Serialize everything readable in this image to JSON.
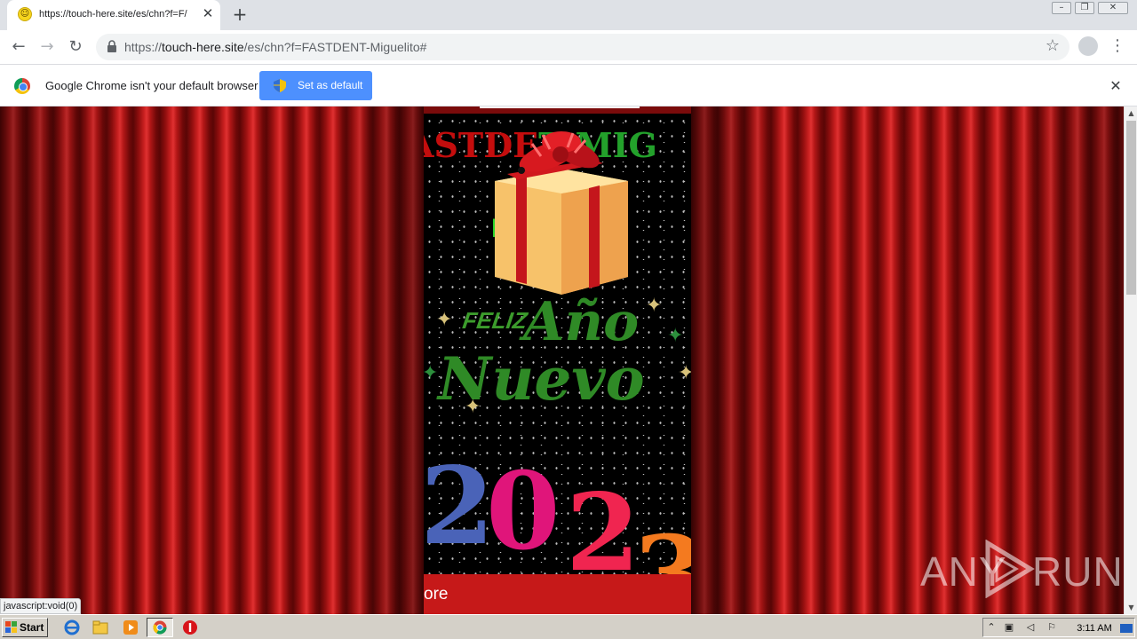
{
  "tab": {
    "title": "https://touch-here.site/es/chn?f=F/",
    "favicon": "smiley-icon"
  },
  "address_bar": {
    "url_prefix": "https://",
    "url_domain": "touch-here.site",
    "url_path": "/es/chn?f=FASTDENT-Miguelito#"
  },
  "infobar": {
    "message": "Google Chrome isn't your default browser",
    "button_label": "Set as default"
  },
  "page": {
    "headline_red": "ASTDE",
    "headline_green": "T MIG",
    "green_text": "M    o",
    "greeting_word1": "FELIZ",
    "greeting_word2": "Año",
    "greeting_word3": "Nuevo",
    "year_digits": [
      "2",
      "0",
      "2",
      "3"
    ],
    "banner_text": "ore"
  },
  "watermark": {
    "left": "ANY",
    "right": "RUN"
  },
  "status_bubble": "javascript:void(0)",
  "taskbar": {
    "start_label": "Start",
    "clock": "3:11 AM"
  },
  "colors": {
    "curtain": "#c81f1f",
    "banner": "#c61919",
    "omnibox": "#f1f3f4",
    "button_blue": "#4d90fe"
  }
}
